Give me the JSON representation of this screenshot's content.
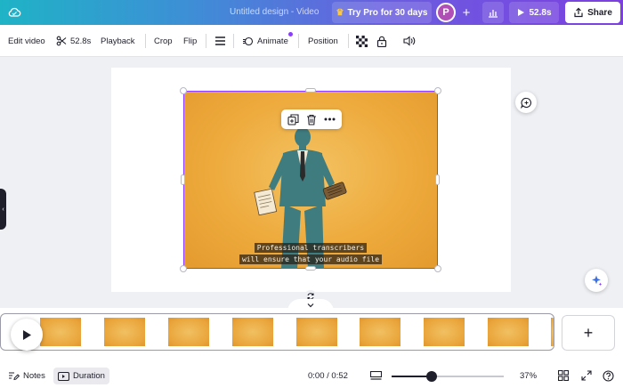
{
  "topbar": {
    "doc_title": "Untitled design - Video",
    "try_pro": "Try Pro for 30 days",
    "avatar_letter": "P",
    "duration": "52.8s",
    "share": "Share"
  },
  "toolbar": {
    "edit_video": "Edit video",
    "trim_duration": "52.8s",
    "playback": "Playback",
    "crop": "Crop",
    "flip": "Flip",
    "animate": "Animate",
    "position": "Position"
  },
  "canvas": {
    "caption_line1": "Professional transcribers",
    "caption_line2": "will ensure that your audio file"
  },
  "timeline": {
    "add_scene": "+"
  },
  "bottombar": {
    "notes": "Notes",
    "duration": "Duration",
    "time": "0:00 / 0:52",
    "zoom": "37%",
    "zoom_fraction": 0.32
  },
  "colors": {
    "accent": "#8b3dff",
    "video_bg": "#eeaa3c"
  }
}
